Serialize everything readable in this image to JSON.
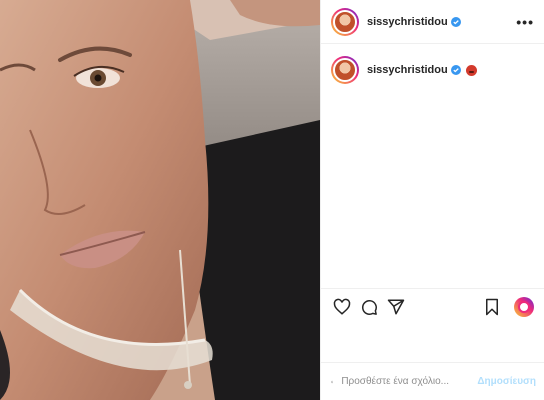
{
  "post": {
    "username": "sissychristidou",
    "verified": true,
    "more_label": "•••",
    "caption_emoji": "red-face-emoji"
  },
  "actions": {
    "icons": [
      "heart-icon",
      "comment-icon",
      "share-icon",
      "bookmark-icon"
    ]
  },
  "comment": {
    "placeholder": "Προσθέστε ένα σχόλιο...",
    "post_label": "Δημοσίευση"
  },
  "colors": {
    "verified_blue": "#3897f0",
    "post_button_disabled": "#b2dffc",
    "divider": "#efefef"
  }
}
